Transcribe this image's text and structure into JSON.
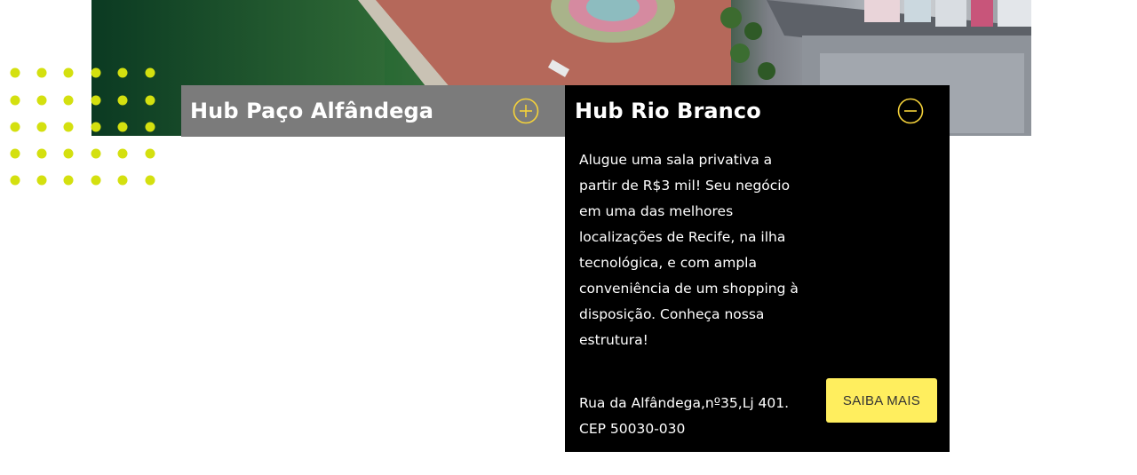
{
  "colors": {
    "accent_yellow": "#ffee5e",
    "icon_yellow": "#f5d23a",
    "dot_green": "#d4e00f",
    "collapsed_bg": "#7b7b7b",
    "expanded_bg": "#000000"
  },
  "hubs": [
    {
      "title": "Hub Paço Alfândega",
      "state": "collapsed",
      "toggle_icon": "plus-circle-icon"
    },
    {
      "title": "Hub Rio Branco",
      "state": "expanded",
      "toggle_icon": "minus-circle-icon",
      "description": "Alugue uma sala privativa a partir de R$3 mil! Seu negócio em uma das melhores localizações de Recife, na ilha tecnológica, e com ampla conveniência de um shopping à disposição. Conheça nossa estrutura!",
      "address_line1": "Rua da Alfândega,nº35,Lj 401.",
      "address_line2": "CEP 50030-030",
      "cta_label": "SAIBA MAIS"
    }
  ]
}
